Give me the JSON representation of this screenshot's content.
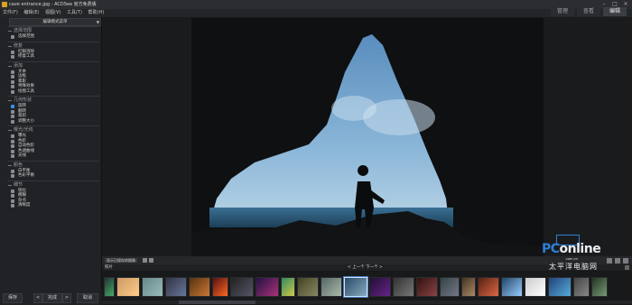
{
  "titlebar": {
    "title": "cave entrance.jpg - ACDSee 官方免费版"
  },
  "menubar": {
    "items": [
      "文件(F)",
      "编辑(E)",
      "视图(V)",
      "工具(T)",
      "帮助(H)"
    ]
  },
  "mode_tabs": [
    "管理",
    "查看",
    "编辑"
  ],
  "sidebar": {
    "mode_select": "编辑模式菜单",
    "groups": [
      {
        "title": "选择范围",
        "items": [
          "选择范围"
        ]
      },
      {
        "title": "修复",
        "items": [
          "红眼消除",
          "修复工具"
        ]
      },
      {
        "title": "添加",
        "items": [
          "文本",
          "边框",
          "晕影",
          "特殊效果",
          "绘图工具"
        ]
      },
      {
        "title": "几何形状",
        "items": [
          "旋转",
          "翻转",
          "裁剪",
          "调整大小"
        ]
      },
      {
        "title": "曝光/光线",
        "items": [
          "曝光",
          "色阶",
          "自动色阶",
          "色调曲线",
          "光线"
        ]
      },
      {
        "title": "颜色",
        "items": [
          "白平衡",
          "色彩平衡"
        ]
      },
      {
        "title": "细节",
        "items": [
          "锐化",
          "模糊",
          "杂点",
          "清晰度"
        ]
      }
    ],
    "selected_item": "旋转"
  },
  "bottom": {
    "save": "保存",
    "done": "完成",
    "cancel": "取消",
    "prev_arrow": "<",
    "next_arrow": ">"
  },
  "filmstrip": {
    "show_checkbox": "显示已保存的图像",
    "label": "照片",
    "pager": "< 上一个  下一个 >"
  },
  "watermark": {
    "brand_a": "PC",
    "brand_b": "online",
    "domain": ".com.cn",
    "cn": "太平洋电脑网"
  },
  "colors": {
    "accent": "#3a8ee6",
    "sky": "#6f9fc9",
    "sea": "#2d5a78"
  }
}
